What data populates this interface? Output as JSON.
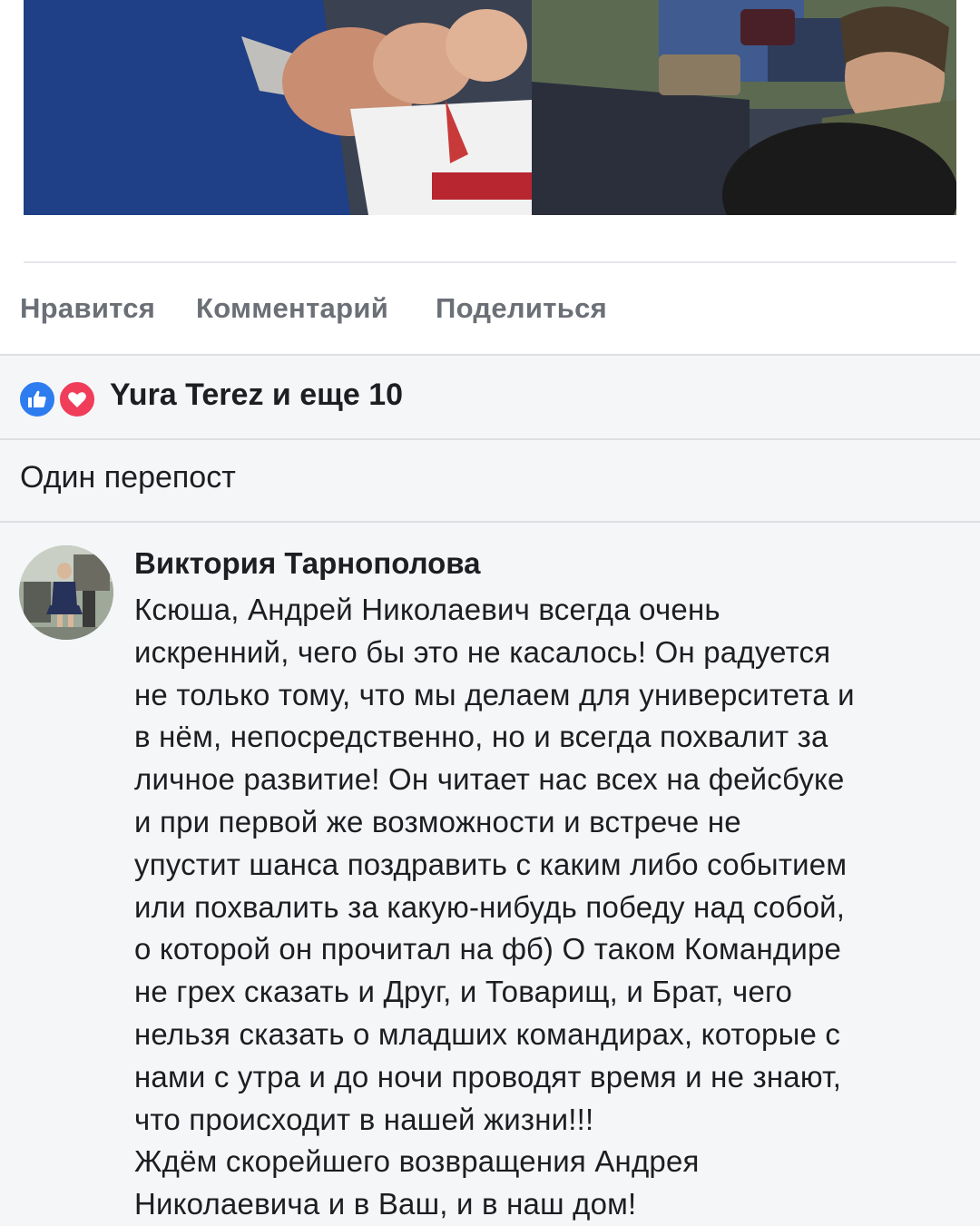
{
  "post": {
    "photo_description_icon": "photo-image"
  },
  "actions": {
    "like_label": "Нравится",
    "comment_label": "Комментарий",
    "share_label": "Поделиться"
  },
  "reactions": {
    "icons": [
      "like-icon",
      "love-icon"
    ],
    "summary": "Yura Terez и еще 10"
  },
  "reposts": {
    "text": "Один перепост"
  },
  "comment": {
    "author": "Виктория Тарнополова",
    "lines": [
      "Ксюша, Андрей Николаевич всегда очень",
      "искренний, чего бы это не касалось! Он радуется",
      "не только тому, что мы делаем для университета и",
      "в нём, непосредственно, но и всегда похвалит за",
      "личное развитие! Он читает нас всех на фейсбуке",
      "и при первой же возможности и встрече не",
      "упустит шанса поздравить с каким либо событием",
      "или похвалить за какую-нибудь победу над собой,",
      "о которой он прочитал на фб) О таком Командире",
      "не грех сказать и Друг, и Товарищ, и Брат, чего",
      "нельзя сказать о младших командирах, которые с",
      "нами с утра и до ночи проводят время и не знают,",
      "что происходит в нашей жизни!!!",
      "Ждём скорейшего возвращения Андрея",
      "Николаевича и в Ваш, и в наш дом!"
    ]
  },
  "colors": {
    "like_blue": "#2d7cf0",
    "love_red": "#ef3d5a",
    "action_grey": "#6b6f76",
    "section_bg": "#f5f6f8"
  }
}
